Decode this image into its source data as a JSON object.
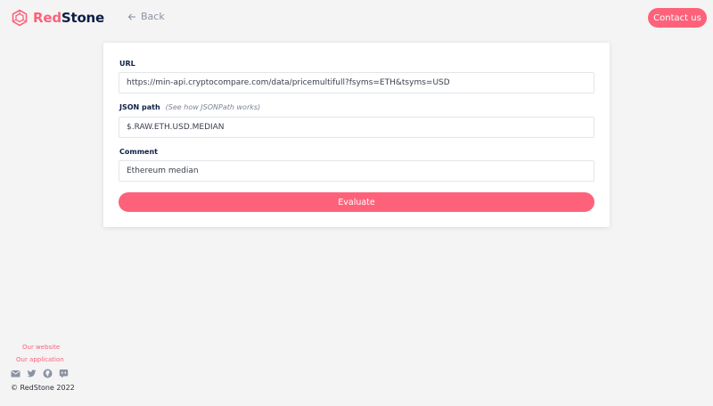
{
  "header": {
    "logo_part1": "Red",
    "logo_part2": "Stone",
    "back_label": "Back",
    "contact_label": "Contact us",
    "icons": {
      "logo": "hexagon-logo-icon",
      "back": "arrow-left-icon"
    }
  },
  "form": {
    "url_label": "URL",
    "url_value": "https://min-api.cryptocompare.com/data/pricemultifull?fsyms=ETH&tsyms=USD",
    "json_path_label": "JSON path",
    "json_path_hint": "(See how JSONPath works)",
    "json_path_value": "$.RAW.ETH.USD.MEDIAN",
    "comment_label": "Comment",
    "comment_value": "Ethereum median",
    "evaluate_label": "Evaluate"
  },
  "footer": {
    "website_label": "Our website",
    "application_label": "Our application",
    "icons": [
      "envelope-icon",
      "twitter-icon",
      "github-icon",
      "discord-icon"
    ],
    "copyright": "© RedStone 2022"
  },
  "colors": {
    "accent": "#fd627a",
    "brand_dark": "#0c1f46",
    "background": "#f4f4f4"
  }
}
